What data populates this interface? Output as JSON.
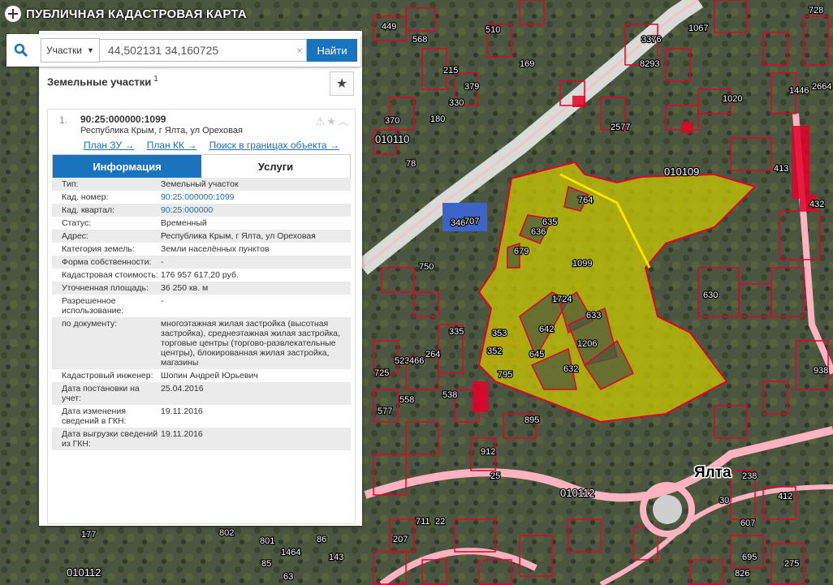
{
  "app": {
    "title": "ПУБЛИЧНАЯ КАДАСТРОВАЯ КАРТА"
  },
  "search": {
    "type_label": "Участки",
    "query": "44,502131 34,160725",
    "button": "Найти",
    "clear": "×"
  },
  "panel": {
    "header": "Земельные участки",
    "count": "1"
  },
  "parcel": {
    "index": "1.",
    "cad_number": "90:25:000000:1099",
    "address": "Республика Крым, г Ялта, ул Ореховая",
    "links": [
      "План ЗУ →",
      "План КК →",
      "Поиск в границах объекта →"
    ],
    "tabs": [
      "Информация",
      "Услуги"
    ],
    "rows": [
      {
        "k": "Тип:",
        "v": "Земельный участок"
      },
      {
        "k": "Кад. номер:",
        "v": "90:25:000000:1099",
        "link": true
      },
      {
        "k": "Кад. квартал:",
        "v": "90:25:000000",
        "link": true
      },
      {
        "k": "Статус:",
        "v": "Временный"
      },
      {
        "k": "Адрес:",
        "v": "Республика Крым, г Ялта, ул Ореховая"
      },
      {
        "k": "Категория земель:",
        "v": "Земли населённых пунктов"
      },
      {
        "k": "Форма собственности:",
        "v": "-"
      },
      {
        "k": "Кадастровая стоимость:",
        "v": "176 957 617,20 руб."
      },
      {
        "k": "Уточненная площадь:",
        "v": "36 250 кв. м"
      },
      {
        "k": "Разрешенное использование:",
        "v": "-"
      },
      {
        "k": "по документу:",
        "v": "многоэтажная жилая застройка (высотная застройка), среднеэтажная жилая застройка, торговые центры (торгово-развлекательные центры), блокированная жилая застройка, магазины"
      },
      {
        "k": "Кадастровый инженер:",
        "v": "Шопин Андрей Юрьевич"
      },
      {
        "k": "Дата постановки на учет:",
        "v": "25.04.2016"
      },
      {
        "k": "Дата изменения сведений в ГКН:",
        "v": "19.11.2016"
      },
      {
        "k": "Дата выгрузки сведений из ГКН:",
        "v": "19.11.2016"
      }
    ]
  },
  "map": {
    "city_label": "Ялта",
    "quarter_labels": [
      "010110",
      "010109",
      "010112",
      "010112"
    ],
    "parcel_labels": [
      "1099",
      "764",
      "635",
      "636",
      "679",
      "1724",
      "642",
      "633",
      "1206",
      "632",
      "645",
      "795",
      "353",
      "352",
      "895",
      "912",
      "25",
      "630",
      "346",
      "707",
      "750",
      "335",
      "264",
      "523",
      "466",
      "725",
      "558",
      "538",
      "577",
      "413",
      "432",
      "728",
      "1020",
      "2577",
      "169",
      "510",
      "449",
      "568",
      "215",
      "379",
      "330",
      "180",
      "370",
      "78",
      "8293",
      "3376",
      "1067",
      "1446",
      "2664",
      "938",
      "238",
      "412",
      "607",
      "30",
      "177",
      "802",
      "801",
      "86",
      "1464",
      "143",
      "85",
      "63",
      "695",
      "826",
      "275",
      "711",
      "22",
      "207"
    ]
  },
  "colors": {
    "accent": "#1a73bd",
    "parcel_fill": "#c8c800",
    "parcel_border": "#e4002b"
  }
}
